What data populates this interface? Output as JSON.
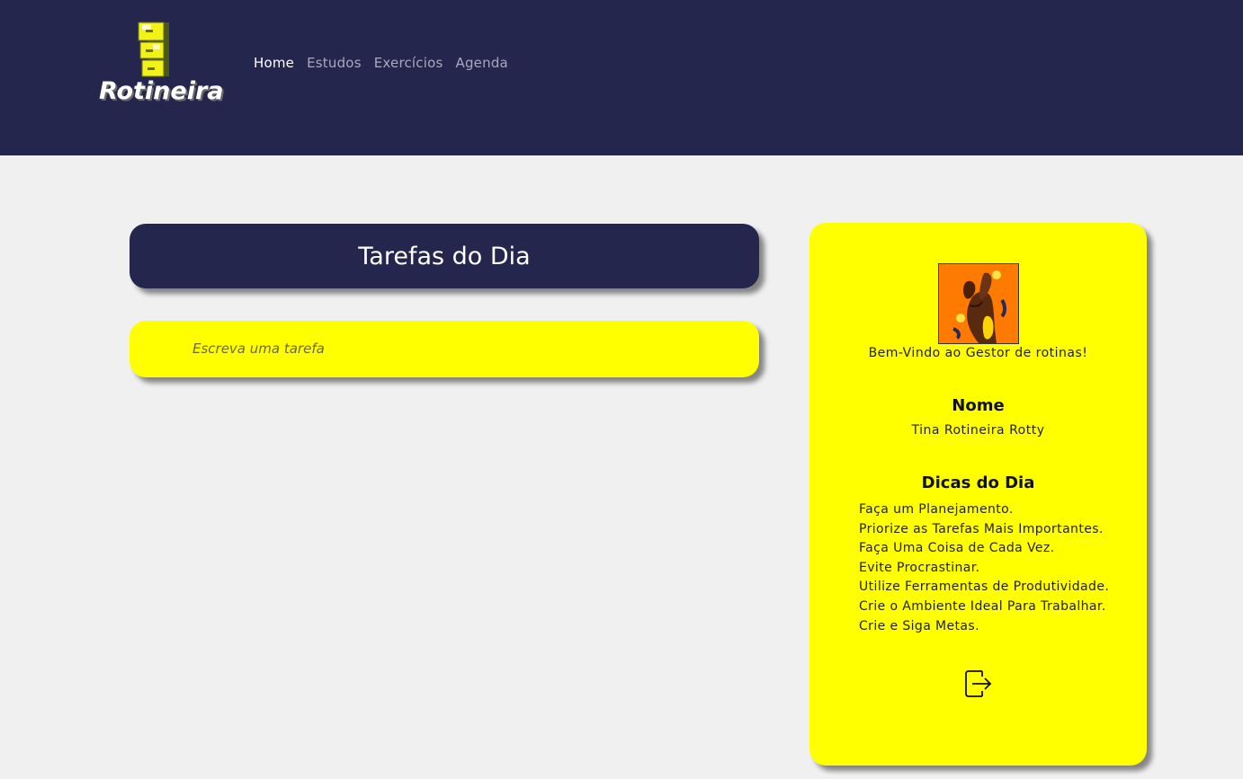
{
  "header": {
    "logo_text": "Rotineira",
    "nav": [
      {
        "label": "Home",
        "active": true
      },
      {
        "label": "Estudos",
        "active": false
      },
      {
        "label": "Exercícios",
        "active": false
      },
      {
        "label": "Agenda",
        "active": false
      }
    ]
  },
  "main": {
    "title": "Tarefas do Dia",
    "task_input": {
      "placeholder": "Escreva uma tarefa",
      "value": ""
    }
  },
  "sidebar": {
    "welcome": "Bem-Vindo ao Gestor de rotinas!",
    "name_title": "Nome",
    "name_value": "Tina Rotineira Rotty",
    "tips_title": "Dicas do Dia",
    "tips": [
      "Faça um Planejamento.",
      "Priorize as Tarefas Mais Importantes.",
      "Faça Uma Coisa de Cada Vez.",
      "Evite Procrastinar.",
      "Utilize Ferramentas de Produtividade.",
      "Crie o Ambiente Ideal Para Trabalhar.",
      "Crie e Siga Metas."
    ],
    "logout_icon": "logout-icon"
  },
  "colors": {
    "header_bg": "#25264d",
    "card_yellow": "#ffff00",
    "page_bg": "#f0f0f0",
    "avatar_bg": "#ff7a00"
  }
}
